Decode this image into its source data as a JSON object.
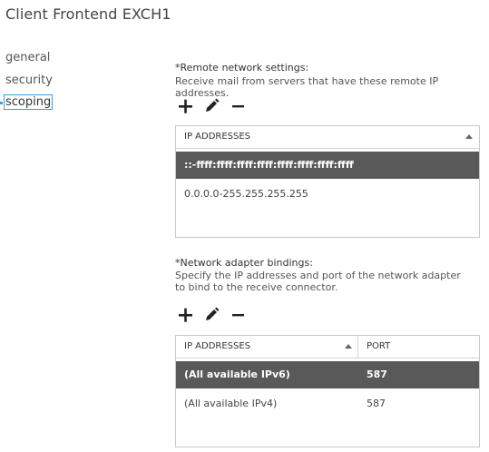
{
  "window": {
    "title": "Client Frontend EXCH1"
  },
  "nav": {
    "items": [
      {
        "label": "general"
      },
      {
        "label": "security"
      },
      {
        "label": "scoping",
        "selected": true
      }
    ]
  },
  "remote_network": {
    "label": "*Remote network settings:",
    "description": "Receive mail from servers that have these remote IP addresses.",
    "toolbar": {
      "add_icon": "plus-icon",
      "edit_icon": "pencil-icon",
      "remove_icon": "minus-icon"
    },
    "grid": {
      "column_header": "IP ADDRESSES",
      "rows": [
        {
          "value": "::-ffff:ffff:ffff:ffff:ffff:ffff:ffff:ffff",
          "selected": true
        },
        {
          "value": "0.0.0.0-255.255.255.255",
          "selected": false
        }
      ]
    }
  },
  "adapter_bindings": {
    "label": "*Network adapter bindings:",
    "description": "Specify the IP addresses and port of the network adapter to bind to the receive connector.",
    "toolbar": {
      "add_icon": "plus-icon",
      "edit_icon": "pencil-icon",
      "remove_icon": "minus-icon"
    },
    "grid": {
      "column_headers": [
        "IP ADDRESSES",
        "PORT"
      ],
      "rows": [
        {
          "ip": "(All available IPv6)",
          "port": "587",
          "selected": true
        },
        {
          "ip": "(All available IPv4)",
          "port": "587",
          "selected": false
        }
      ]
    }
  },
  "colors": {
    "selected_row_bg": "#595959",
    "selection_accent": "#3a9bdc",
    "border": "#c8c8c8"
  }
}
